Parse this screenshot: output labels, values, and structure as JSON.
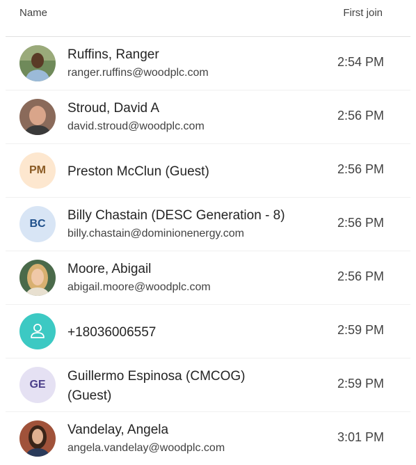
{
  "header": {
    "name_label": "Name",
    "first_join_label": "First join"
  },
  "participants": [
    {
      "name": "Ruffins, Ranger",
      "email": "ranger.ruffins@woodplc.com",
      "time": "2:54 PM",
      "avatar": "photo"
    },
    {
      "name": "Stroud, David A",
      "email": "david.stroud@woodplc.com",
      "time": "2:56 PM",
      "avatar": "photo"
    },
    {
      "name": "Preston McClun (Guest)",
      "email": "",
      "time": "2:56 PM",
      "avatar": "PM",
      "avatar_bg": "#fde7cf",
      "avatar_fg": "#8a5a23"
    },
    {
      "name": "Billy Chastain (DESC Generation - 8)",
      "email": "billy.chastain@dominionenergy.com",
      "time": "2:56 PM",
      "avatar": "BC",
      "avatar_bg": "#d8e5f5",
      "avatar_fg": "#1e4f8a"
    },
    {
      "name": "Moore, Abigail",
      "email": "abigail.moore@woodplc.com",
      "time": "2:56 PM",
      "avatar": "photo"
    },
    {
      "name": "+18036006557",
      "email": "",
      "time": "2:59 PM",
      "avatar": "person-icon",
      "avatar_bg": "#3cc9c3"
    },
    {
      "name": "Guillermo Espinosa (CMCOG)",
      "name2": "(Guest)",
      "email": "",
      "time": "2:59 PM",
      "avatar": "GE",
      "avatar_bg": "#e5e1f3",
      "avatar_fg": "#4b3f8a"
    },
    {
      "name": "Vandelay, Angela",
      "email": "angela.vandelay@woodplc.com",
      "time": "3:01 PM",
      "avatar": "photo"
    }
  ]
}
